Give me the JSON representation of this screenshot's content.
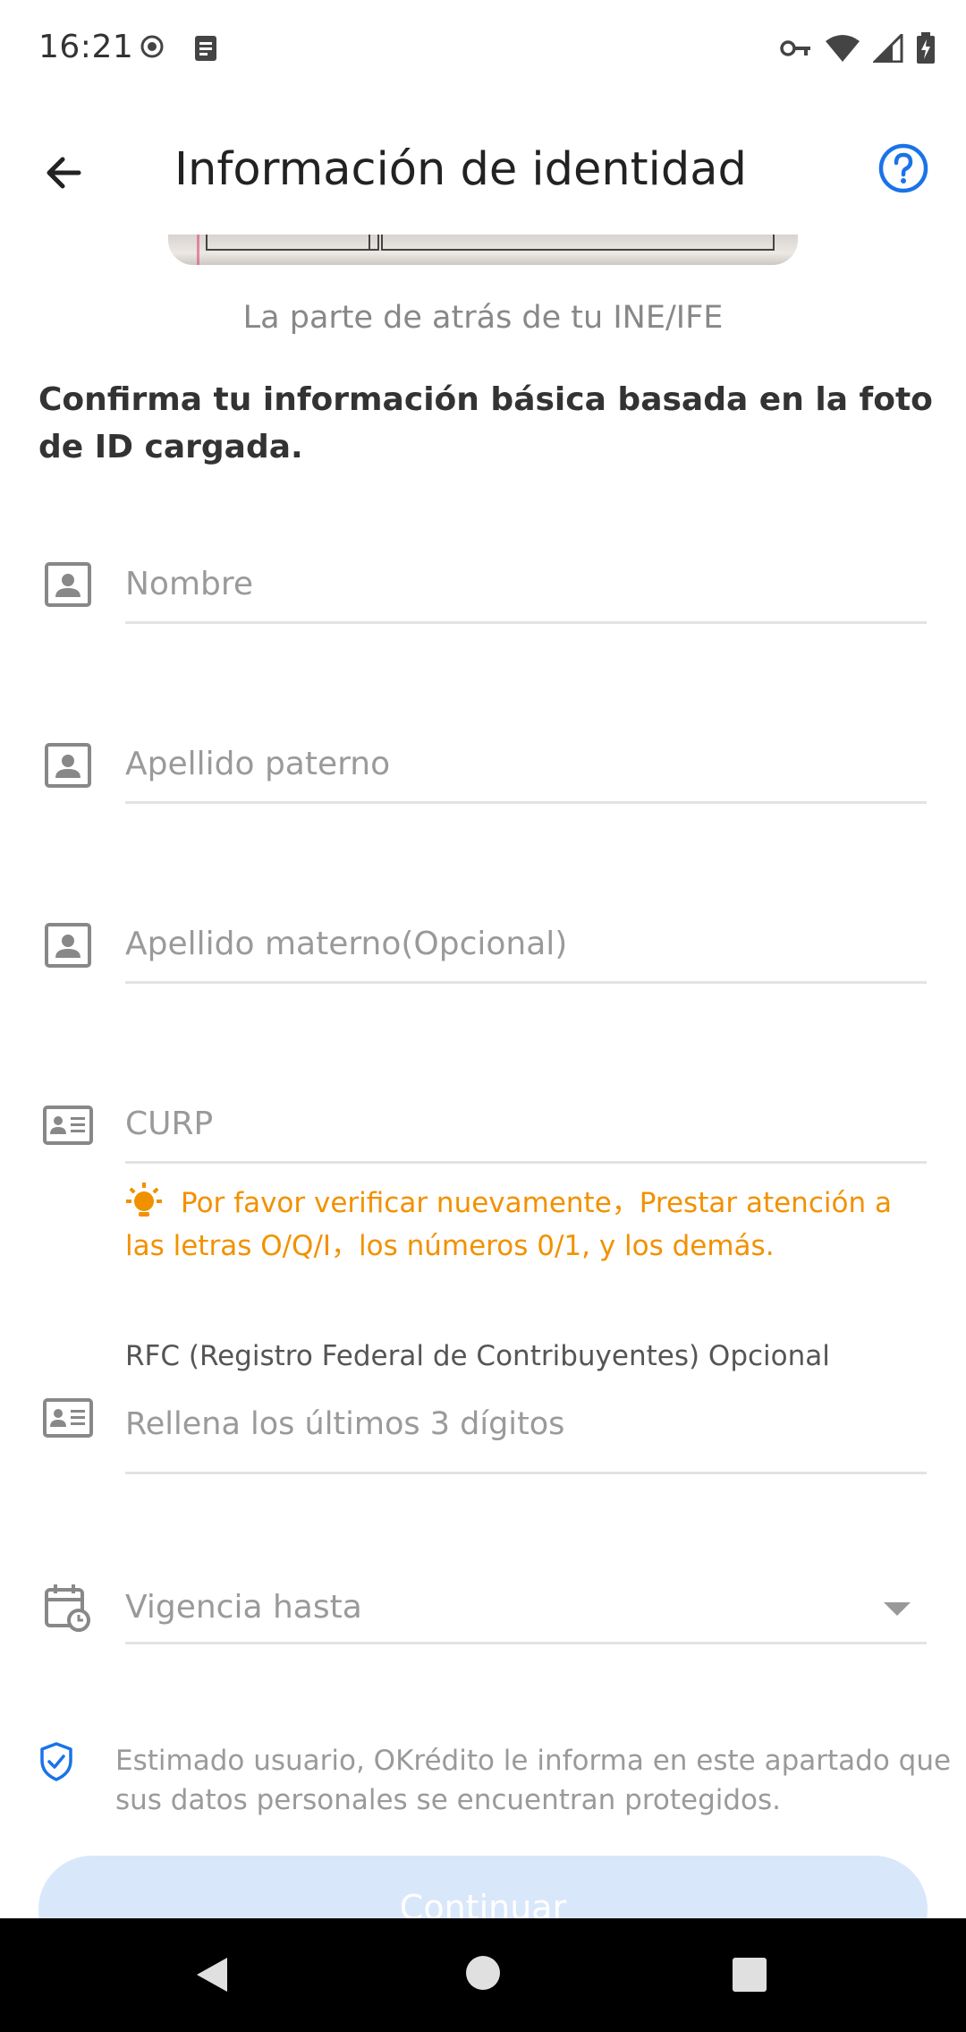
{
  "status_bar": {
    "time": "16:21"
  },
  "app_bar": {
    "title": "Información de identidad",
    "back_icon": "arrow-left-icon",
    "help_icon": "question-circle-icon"
  },
  "id_preview": {
    "caption": "La parte de atrás de tu INE/IFE"
  },
  "intro_text": "Confirma tu información básica basada en la foto de ID cargada.",
  "fields": {
    "nombre": {
      "placeholder": "Nombre",
      "value": "",
      "icon": "person-card-icon"
    },
    "apellido_paterno": {
      "placeholder": "Apellido paterno",
      "value": "",
      "icon": "person-card-icon"
    },
    "apellido_materno": {
      "placeholder": "Apellido materno(Opcional)",
      "value": "",
      "icon": "person-card-icon"
    },
    "curp": {
      "placeholder": "CURP",
      "value": "",
      "icon": "id-card-icon"
    },
    "rfc": {
      "label": "RFC (Registro Federal de Contribuyentes) Opcional",
      "placeholder": "Rellena los últimos 3 dígitos",
      "value": "",
      "icon": "id-card-icon"
    },
    "vigencia": {
      "placeholder": "Vigencia hasta",
      "value": "",
      "icon": "calendar-clock-icon"
    }
  },
  "curp_warning": "Por favor verificar nuevamente，Prestar atención a las letras O/Q/I，los números 0/1, y los demás.",
  "privacy_note": "Estimado usuario, OKrédito le informa en este apartado que sus datos personales se encuentran protegidos.",
  "continue_button": "Continuar",
  "colors": {
    "accent_blue": "#1a73e8",
    "warning_orange": "#f29100",
    "button_disabled": "#d9e7fb"
  }
}
